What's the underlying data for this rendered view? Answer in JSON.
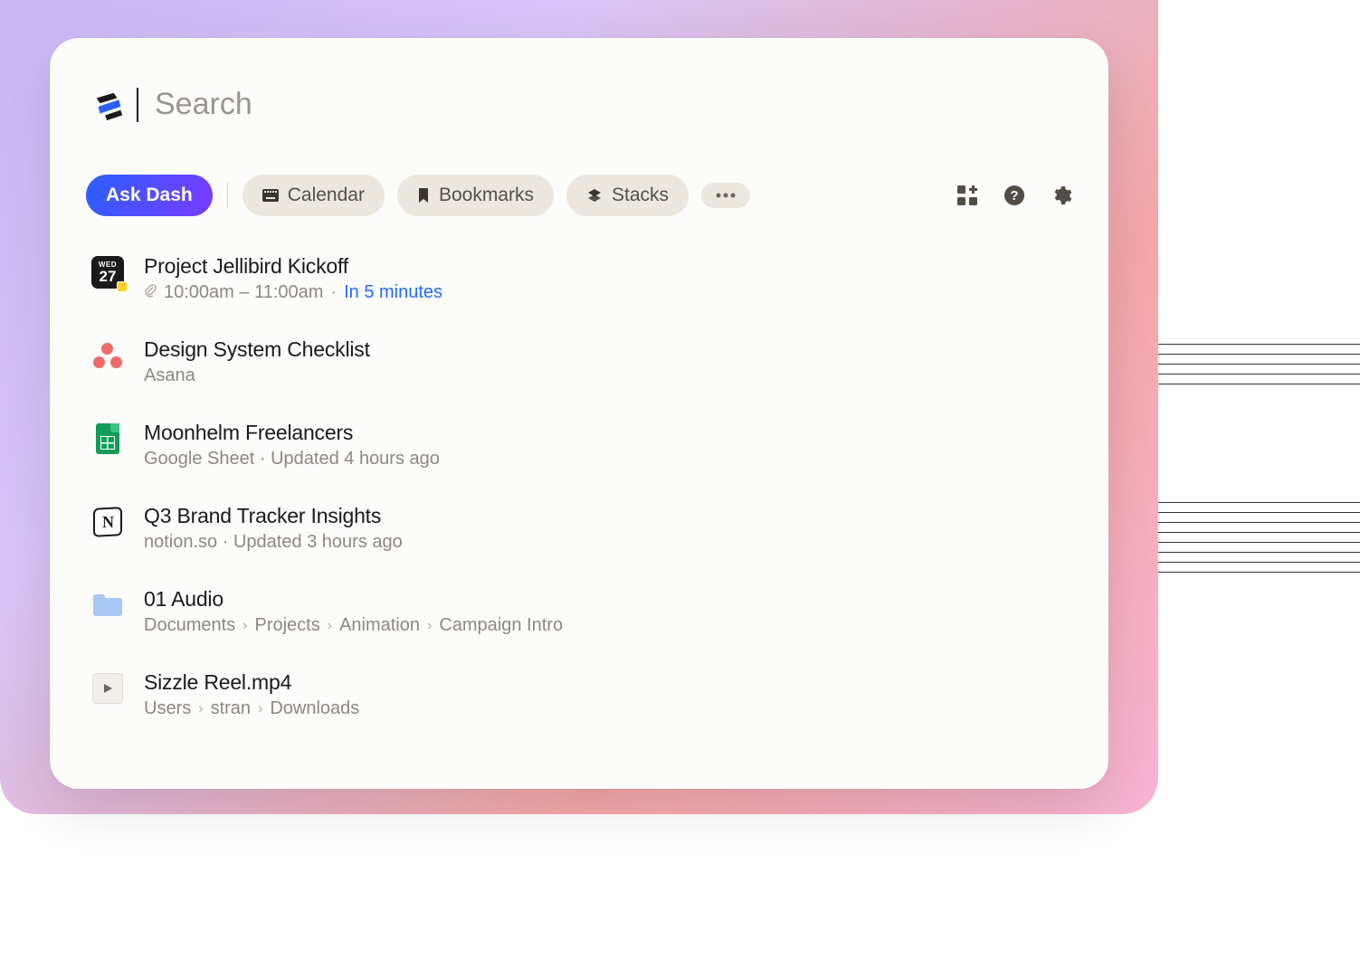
{
  "search": {
    "placeholder": "Search",
    "value": ""
  },
  "chips": {
    "ask": "Ask Dash",
    "calendar": "Calendar",
    "bookmarks": "Bookmarks",
    "stacks": "Stacks"
  },
  "calendar_badge": {
    "dow": "WED",
    "day": "27"
  },
  "results": [
    {
      "title": "Project Jellibird Kickoff",
      "time": "10:00am – 11:00am",
      "sep": "·",
      "relative": "In 5 minutes"
    },
    {
      "title": "Design System Checklist",
      "source": "Asana"
    },
    {
      "title": "Moonhelm Freelancers",
      "meta": "Google Sheet · Updated 4 hours ago"
    },
    {
      "title": "Q3 Brand Tracker Insights",
      "meta": "notion.so · Updated 3 hours ago"
    },
    {
      "title": "01 Audio",
      "path": [
        "Documents",
        "Projects",
        "Animation",
        "Campaign Intro"
      ]
    },
    {
      "title": "Sizzle Reel.mp4",
      "path": [
        "Users",
        "stran",
        "Downloads"
      ]
    }
  ]
}
